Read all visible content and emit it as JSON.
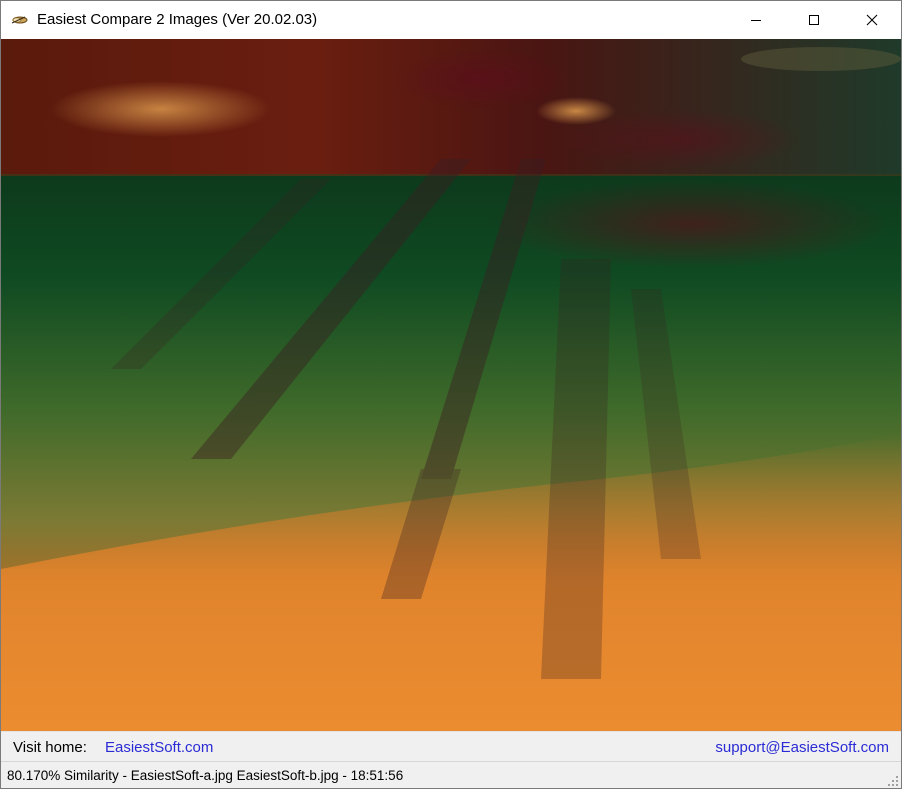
{
  "window": {
    "title": "Easiest Compare 2 Images (Ver 20.02.03)",
    "icon": "app-icon",
    "controls": {
      "minimize_icon": "minimize-icon",
      "maximize_icon": "maximize-icon",
      "close_icon": "close-icon"
    }
  },
  "image_view": {
    "content": "difference-image"
  },
  "linkbar": {
    "visit_label": "Visit home:",
    "home_link": "EasiestSoft.com",
    "support_link": "support@EasiestSoft.com",
    "link_color": "#2b2bd6"
  },
  "statusbar": {
    "text": "80.170% Similarity - EasiestSoft-a.jpg EasiestSoft-b.jpg - 18:51:56"
  }
}
